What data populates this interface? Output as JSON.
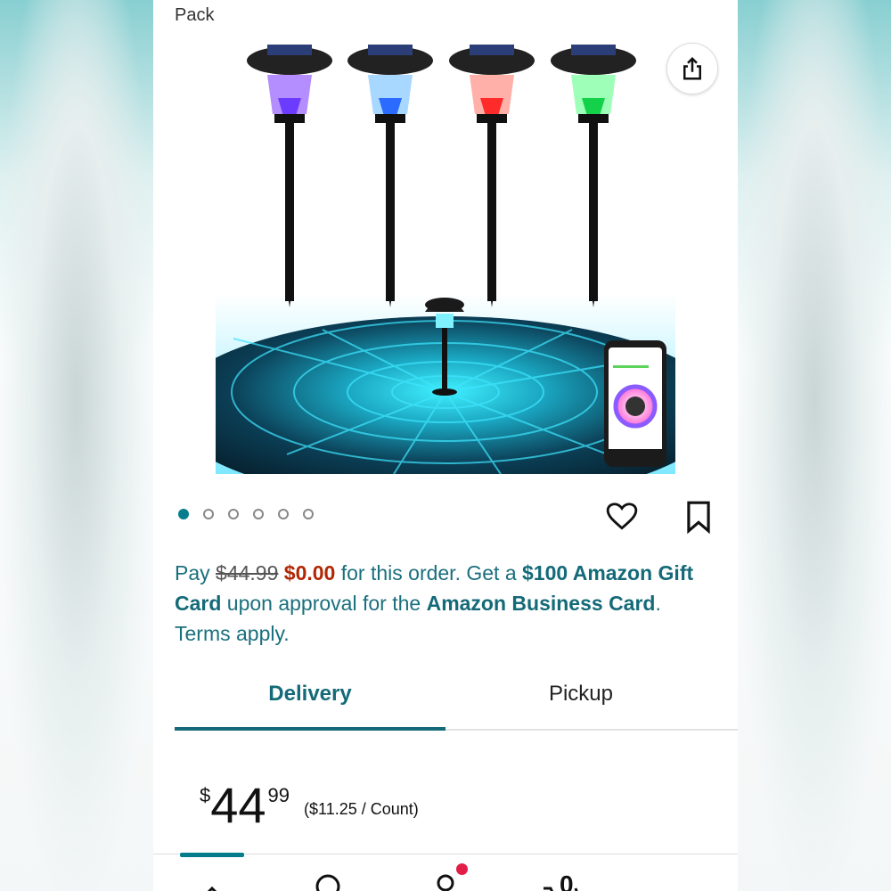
{
  "product": {
    "title_fragment": "Pack",
    "image_alt": "solar pathway lights",
    "carousel_count": 6,
    "carousel_active": 0
  },
  "promo": {
    "pay": "Pay",
    "old_price": "$44.99",
    "new_price": "$0.00",
    "text1": "for this order. Get a",
    "gift": "$100 Amazon Gift Card",
    "text2": "upon approval for the",
    "card": "Amazon Business Card",
    "text3": ". Terms apply."
  },
  "tabs": {
    "delivery": "Delivery",
    "pickup": "Pickup"
  },
  "price": {
    "currency": "$",
    "whole": "44",
    "cents": "99",
    "unit": "($11.25 / Count)"
  },
  "nav": {
    "cart_count": "0"
  },
  "colors": {
    "accent": "#146a78",
    "price_red": "#b12704",
    "badge": "#e11d48"
  }
}
